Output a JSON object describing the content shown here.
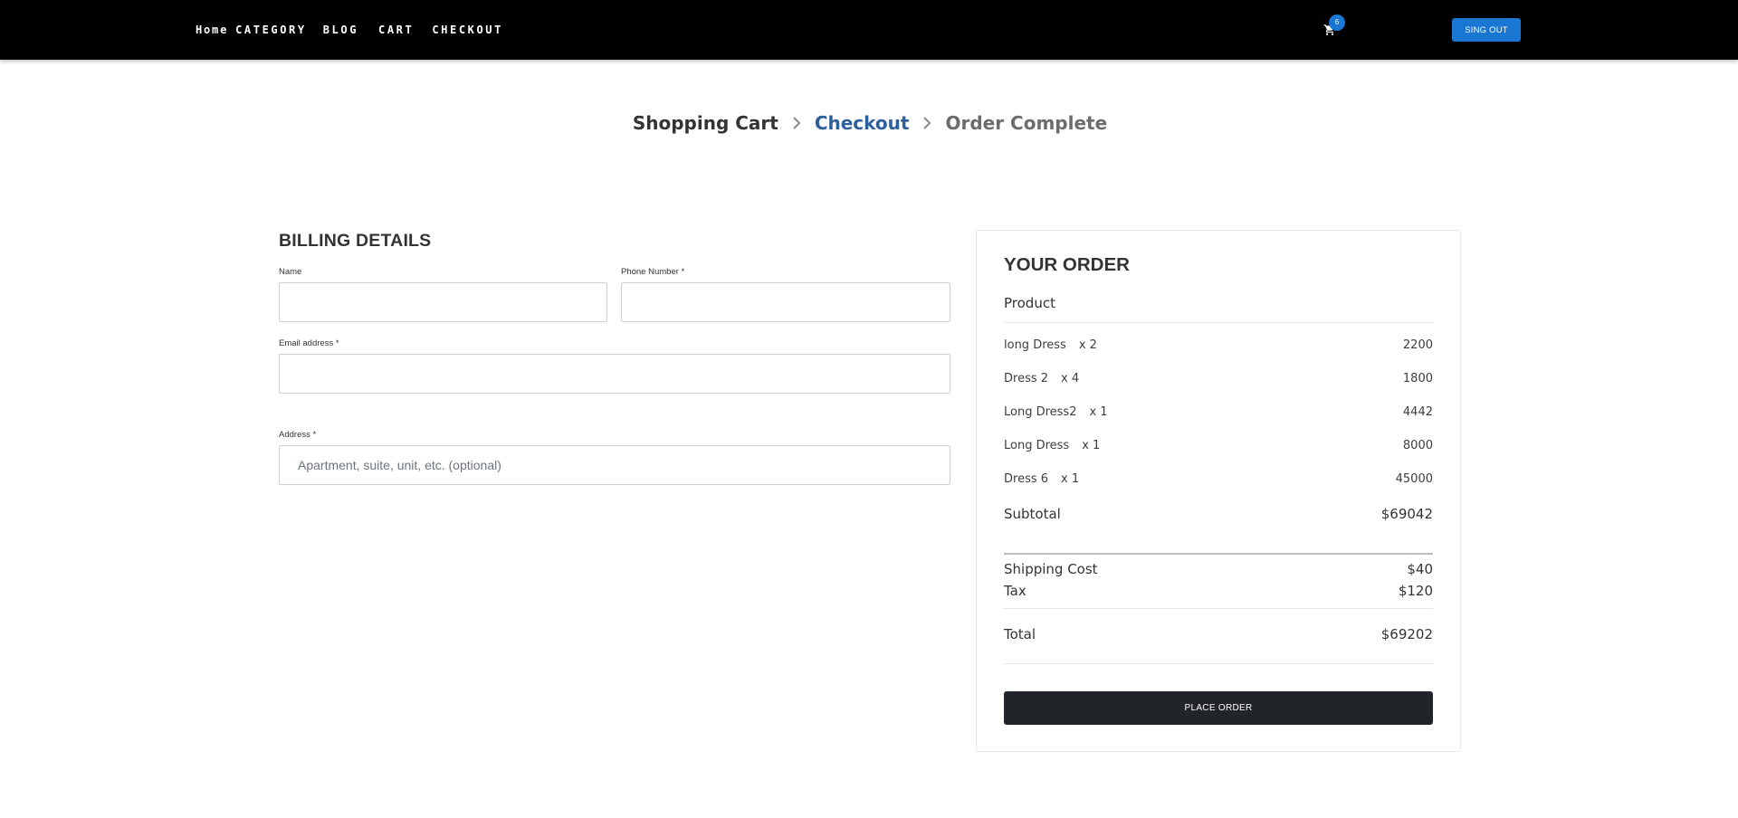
{
  "nav": {
    "links": [
      "Home",
      "CATEGORY",
      "BLOG",
      "CART",
      "CHECKOUT"
    ],
    "cart_count": "6",
    "signout_label": "SING OUT"
  },
  "steps": [
    "Shopping Cart",
    "Checkout",
    "Order Complete"
  ],
  "billing": {
    "title": "BILLING DETAILS",
    "name_label": "Name",
    "phone_label": "Phone Number *",
    "email_label": "Email address *",
    "address_label": "Address *",
    "address_placeholder": "Apartment, suite, unit, etc. (optional)",
    "name_value": "",
    "phone_value": "",
    "email_value": "",
    "address_value": ""
  },
  "order": {
    "title": "YOUR ORDER",
    "product_header": "Product",
    "items": [
      {
        "name": "long Dress",
        "qty": "x 2",
        "price": "2200"
      },
      {
        "name": "Dress 2",
        "qty": "x 4",
        "price": "1800"
      },
      {
        "name": "Long Dress2",
        "qty": "x 1",
        "price": "4442"
      },
      {
        "name": "Long Dress",
        "qty": "x 1",
        "price": "8000"
      },
      {
        "name": "Dress 6",
        "qty": "x 1",
        "price": "45000"
      }
    ],
    "subtotal_label": "Subtotal",
    "subtotal": "$69042",
    "shipping_label": "Shipping Cost",
    "shipping": "$40",
    "tax_label": "Tax",
    "tax": "$120",
    "total_label": "Total",
    "total": "$69202",
    "place_order_label": "PLACE ORDER"
  },
  "colors": {
    "nav_bg": "#000000",
    "accent": "#1976d2",
    "step_active": "#2d5f9a",
    "button_dark": "#212529"
  },
  "icons": [
    "shopping-cart-icon",
    "chevron-right-icon"
  ]
}
